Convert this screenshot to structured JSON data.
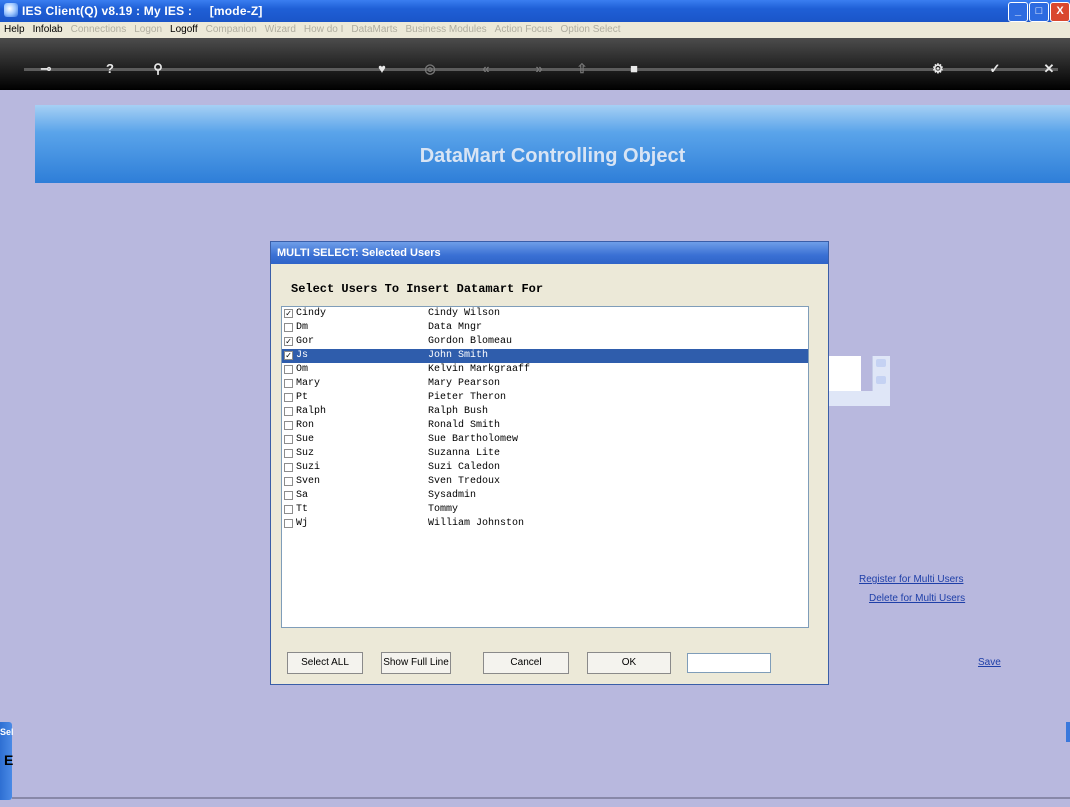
{
  "window": {
    "title": "IES Client(Q) v8.19 : My IES :     [mode-Z]",
    "controls": [
      "_",
      "□",
      "X"
    ]
  },
  "menu": {
    "items": [
      {
        "label": "Help",
        "active": true
      },
      {
        "label": "Infolab",
        "active": true
      },
      {
        "label": "Connections",
        "active": false
      },
      {
        "label": "Logon",
        "active": false
      },
      {
        "label": "Logoff",
        "active": true
      },
      {
        "label": "Companion",
        "active": false
      },
      {
        "label": "Wizard",
        "active": false
      },
      {
        "label": "How do I",
        "active": false
      },
      {
        "label": "DataMarts",
        "active": false
      },
      {
        "label": "Business Modules",
        "active": false
      },
      {
        "label": "Action Focus",
        "active": false
      },
      {
        "label": "Option Select",
        "active": false
      }
    ]
  },
  "header": {
    "title": "DataMart Controlling Object"
  },
  "dialog": {
    "title": "MULTI SELECT: Selected Users",
    "heading": "Select Users To Insert Datamart For",
    "rows": [
      {
        "code": "Cindy",
        "name": "Cindy Wilson",
        "checked": true,
        "selected": false
      },
      {
        "code": "Dm",
        "name": "Data Mngr",
        "checked": false,
        "selected": false
      },
      {
        "code": "Gor",
        "name": "Gordon Blomeau",
        "checked": true,
        "selected": false
      },
      {
        "code": "Js",
        "name": "John Smith",
        "checked": true,
        "selected": true
      },
      {
        "code": "Om",
        "name": "Kelvin Markgraaff",
        "checked": false,
        "selected": false
      },
      {
        "code": "Mary",
        "name": "Mary Pearson",
        "checked": false,
        "selected": false
      },
      {
        "code": "Pt",
        "name": "Pieter Theron",
        "checked": false,
        "selected": false
      },
      {
        "code": "Ralph",
        "name": "Ralph Bush",
        "checked": false,
        "selected": false
      },
      {
        "code": "Ron",
        "name": "Ronald Smith",
        "checked": false,
        "selected": false
      },
      {
        "code": "Sue",
        "name": "Sue Bartholomew",
        "checked": false,
        "selected": false
      },
      {
        "code": "Suz",
        "name": "Suzanna Lite",
        "checked": false,
        "selected": false
      },
      {
        "code": "Suzi",
        "name": "Suzi Caledon",
        "checked": false,
        "selected": false
      },
      {
        "code": "Sven",
        "name": "Sven Tredoux",
        "checked": false,
        "selected": false
      },
      {
        "code": "Sa",
        "name": "Sysadmin",
        "checked": false,
        "selected": false
      },
      {
        "code": "Tt",
        "name": "Tommy",
        "checked": false,
        "selected": false
      },
      {
        "code": "Wj",
        "name": "William Johnston",
        "checked": false,
        "selected": false
      }
    ],
    "buttons": {
      "select_all": "Select ALL",
      "show_full_line": "Show Full Line",
      "cancel": "Cancel",
      "ok": "OK"
    },
    "input_value": ""
  },
  "links": {
    "register": "Register for Multi Users",
    "delete": "Delete for Multi Users",
    "save": "Save"
  },
  "side_tab": {
    "label": "Sel",
    "char": "E"
  },
  "colors": {
    "background": "#b8b8de",
    "title_bar": "#1f5fd6",
    "selection": "#2f5dac",
    "header_band": "#3f8ce0"
  }
}
